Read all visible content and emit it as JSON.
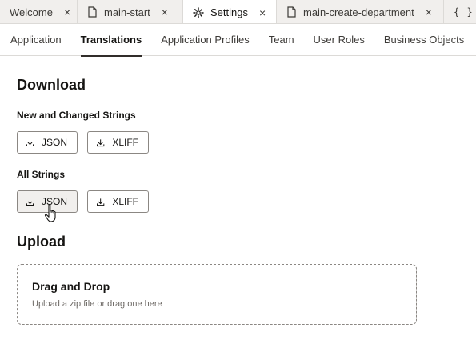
{
  "editor_tabs": [
    {
      "label": "Welcome",
      "icon": "",
      "active": false
    },
    {
      "label": "main-start",
      "icon": "file-icon",
      "active": false
    },
    {
      "label": "Settings",
      "icon": "gear-icon",
      "active": true
    },
    {
      "label": "main-create-department",
      "icon": "file-icon",
      "active": false
    },
    {
      "label": "{ }",
      "icon": "braces-icon",
      "active": false
    }
  ],
  "close_glyph": "×",
  "subtabs": [
    "Application",
    "Translations",
    "Application Profiles",
    "Team",
    "User Roles",
    "Business Objects"
  ],
  "active_subtab": "Translations",
  "download": {
    "title": "Download",
    "new_changed": {
      "label": "New and Changed Strings",
      "json_button": "JSON",
      "xliff_button": "XLIFF"
    },
    "all": {
      "label": "All Strings",
      "json_button": "JSON",
      "xliff_button": "XLIFF"
    }
  },
  "upload": {
    "title": "Upload",
    "drop_title": "Drag and Drop",
    "drop_hint": "Upload a zip file or drag one here"
  }
}
